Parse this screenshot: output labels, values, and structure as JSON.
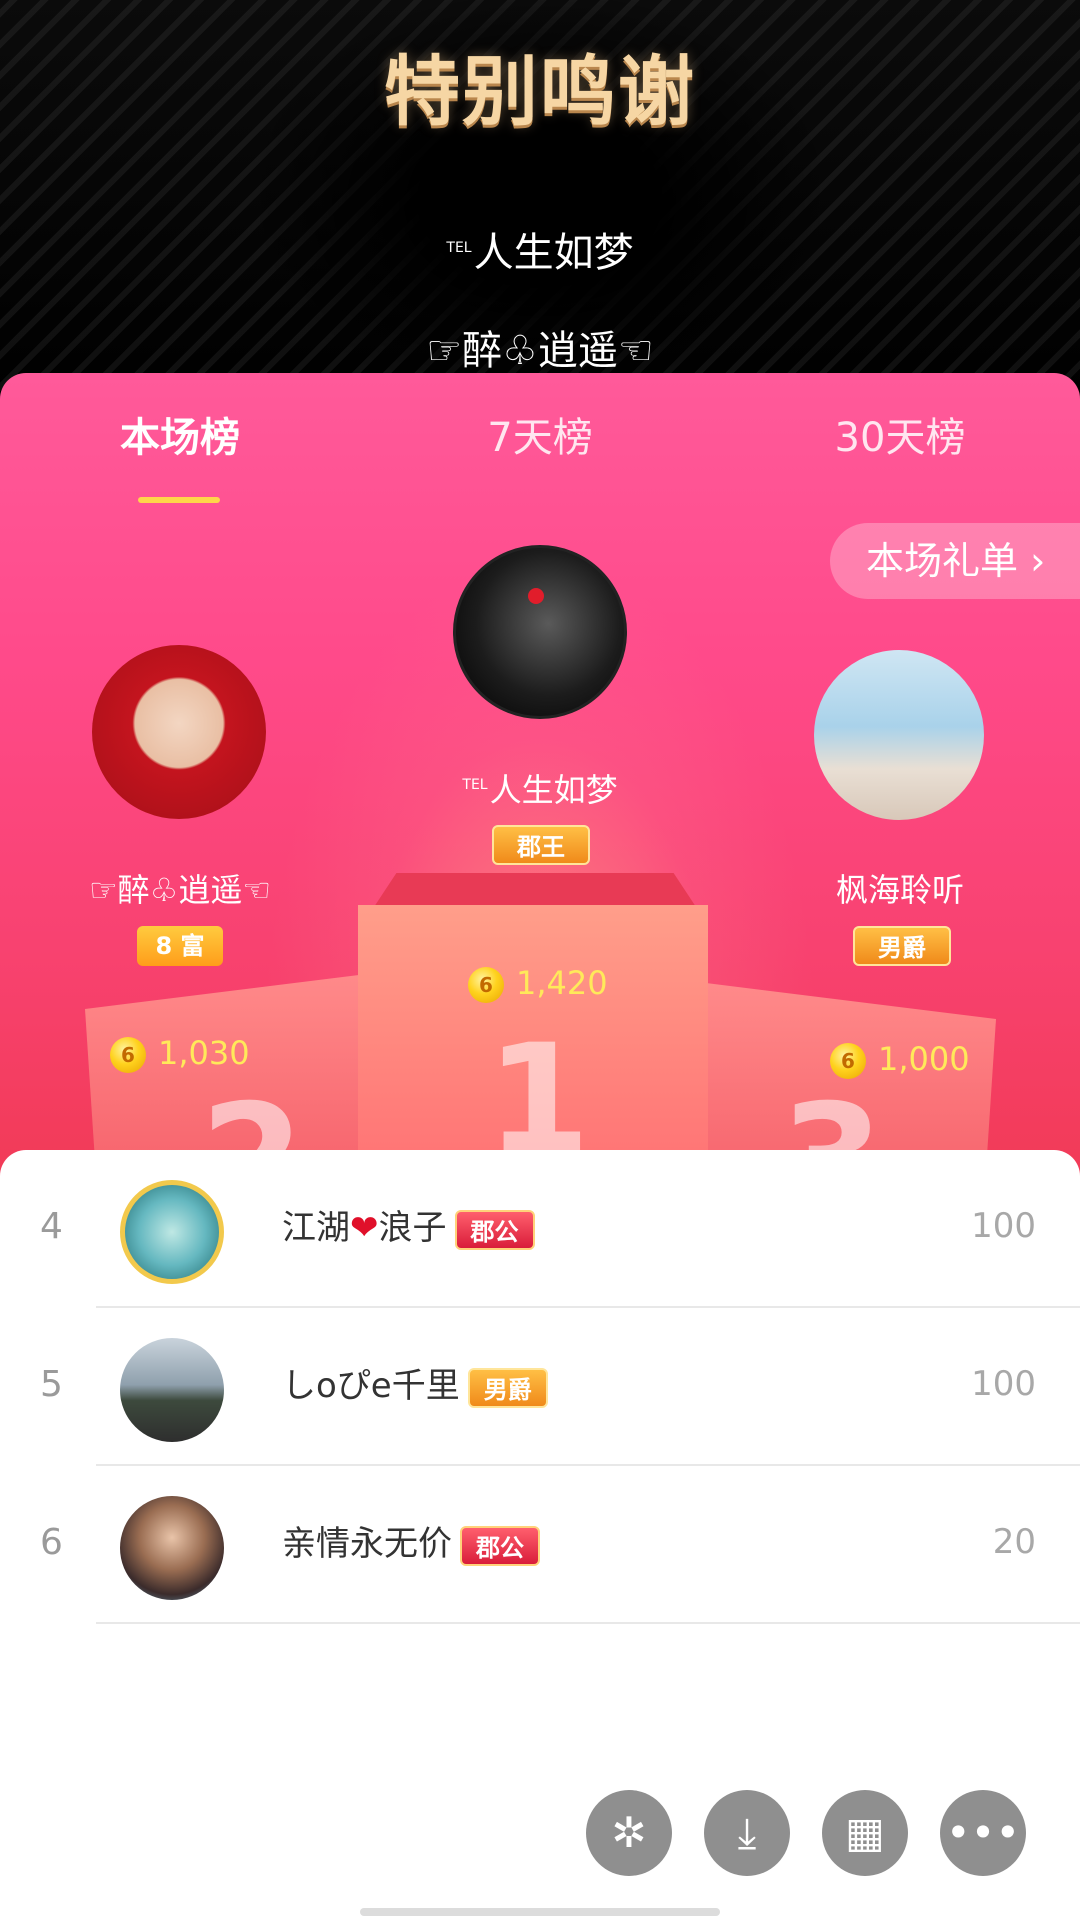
{
  "banner": {
    "title": "特别鸣谢",
    "names": [
      "人生如梦",
      "☞醉♧逍遥☜"
    ],
    "tel_mark": "TEL"
  },
  "tabs": [
    "本场榜",
    "7天榜",
    "30天榜"
  ],
  "active_tab": "本场榜",
  "gift_list_button": "本场礼单 ›",
  "podium": {
    "first": {
      "rank": "1",
      "name": "人生如梦",
      "tel_mark": "TEL",
      "badge": "郡王",
      "coins": "1,420"
    },
    "second": {
      "rank": "2",
      "name": "☞醉♧逍遥☜",
      "badge": "8 富",
      "coins": "1,030"
    },
    "third": {
      "rank": "3",
      "name": "枫海聆听",
      "badge": "男爵",
      "coins": "1,000"
    }
  },
  "coin_symbol": "6",
  "list": [
    {
      "rank": "4",
      "name_prefix": "江湖",
      "heart": "❤",
      "name_suffix": "浪子",
      "badge": "郡公",
      "score": "100"
    },
    {
      "rank": "5",
      "name": "しoぴe千里",
      "badge": "男爵",
      "score": "100"
    },
    {
      "rank": "6",
      "name": "亲情永无价",
      "badge": "郡公",
      "score": "20"
    }
  ],
  "actions": {
    "icons": [
      "moments-icon",
      "save-icon",
      "grid-icon",
      "more-icon"
    ],
    "glyphs": [
      "✲",
      "⤓",
      "▦",
      "•••"
    ]
  },
  "colors": {
    "accent_pink": "#ff4a8a",
    "gold_title": "#f6d6a4",
    "coin_text": "#ffe95a",
    "tab_underline": "#ffd54a"
  }
}
